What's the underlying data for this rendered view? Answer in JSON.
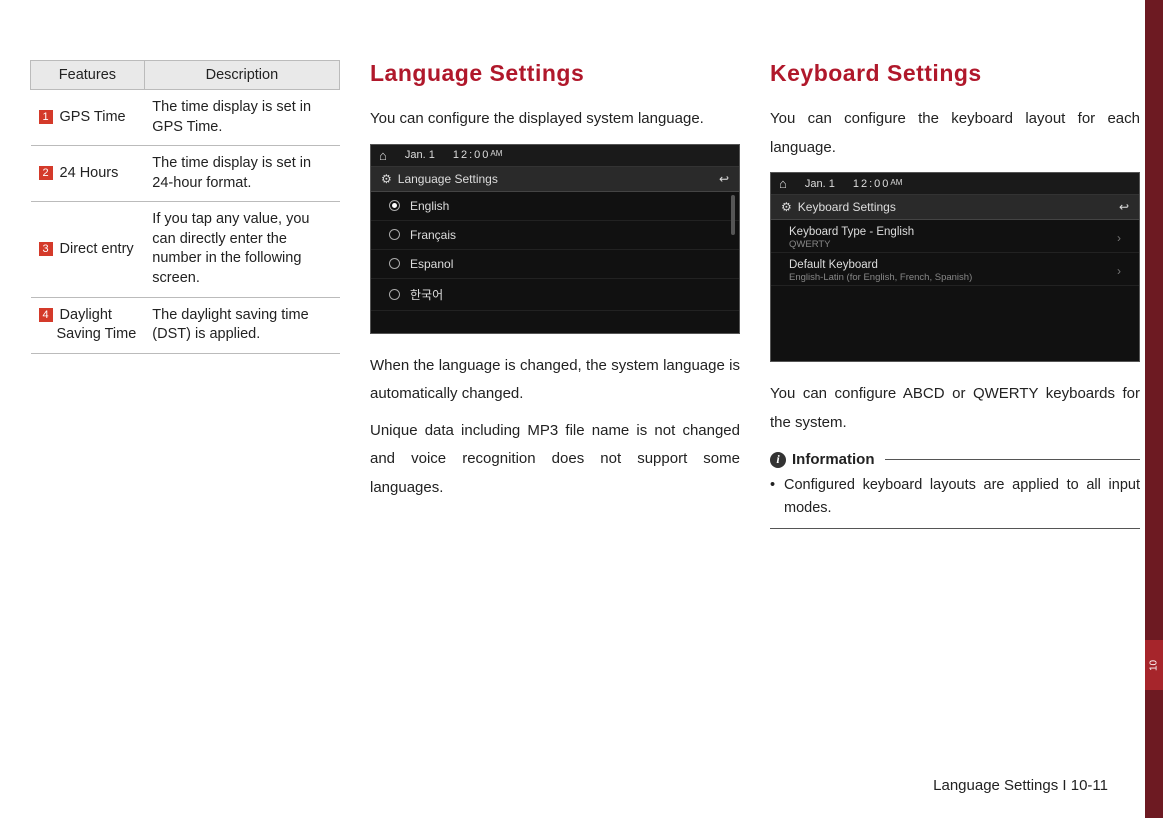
{
  "table": {
    "head_features": "Features",
    "head_description": "Description",
    "rows": [
      {
        "num": "1",
        "feature": "GPS Time",
        "desc": "The time display is set in GPS Time."
      },
      {
        "num": "2",
        "feature": "24 Hours",
        "desc": "The time display is set in 24-hour format."
      },
      {
        "num": "3",
        "feature": "Direct entry",
        "desc": "If you tap any value, you can directly enter the number in the following screen."
      },
      {
        "num": "4",
        "feature": "Daylight",
        "feature_line2": "Saving Time",
        "desc": "The daylight saving time (DST) is applied."
      }
    ]
  },
  "lang": {
    "heading": "Language Settings",
    "intro": "You can configure the displayed system language.",
    "after1": "When the language is changed, the system language is automatically changed.",
    "after2": "Unique data including MP3 file name is not changed and voice recognition does not support some languages.",
    "ss": {
      "date": "Jan. 1",
      "time": "12:00",
      "ampm": "AM",
      "title": "Language Settings",
      "items": [
        "English",
        "Français",
        "Espanol",
        "한국어"
      ]
    }
  },
  "kbd": {
    "heading": "Keyboard Settings",
    "intro": "You can configure the keyboard layout for each language.",
    "after": "You can configure ABCD or QWERTY keyboards for the system.",
    "ss": {
      "date": "Jan. 1",
      "time": "12:00",
      "ampm": "AM",
      "title": "Keyboard Settings",
      "row1_title": "Keyboard Type - English",
      "row1_sub": "QWERTY",
      "row2_title": "Default Keyboard",
      "row2_sub": "English-Latin (for English, French, Spanish)"
    },
    "info_label": "Information",
    "info_item": "Configured keyboard layouts are applied to all input modes."
  },
  "footer": "Language Settings I 10-11",
  "side_tab": "10"
}
